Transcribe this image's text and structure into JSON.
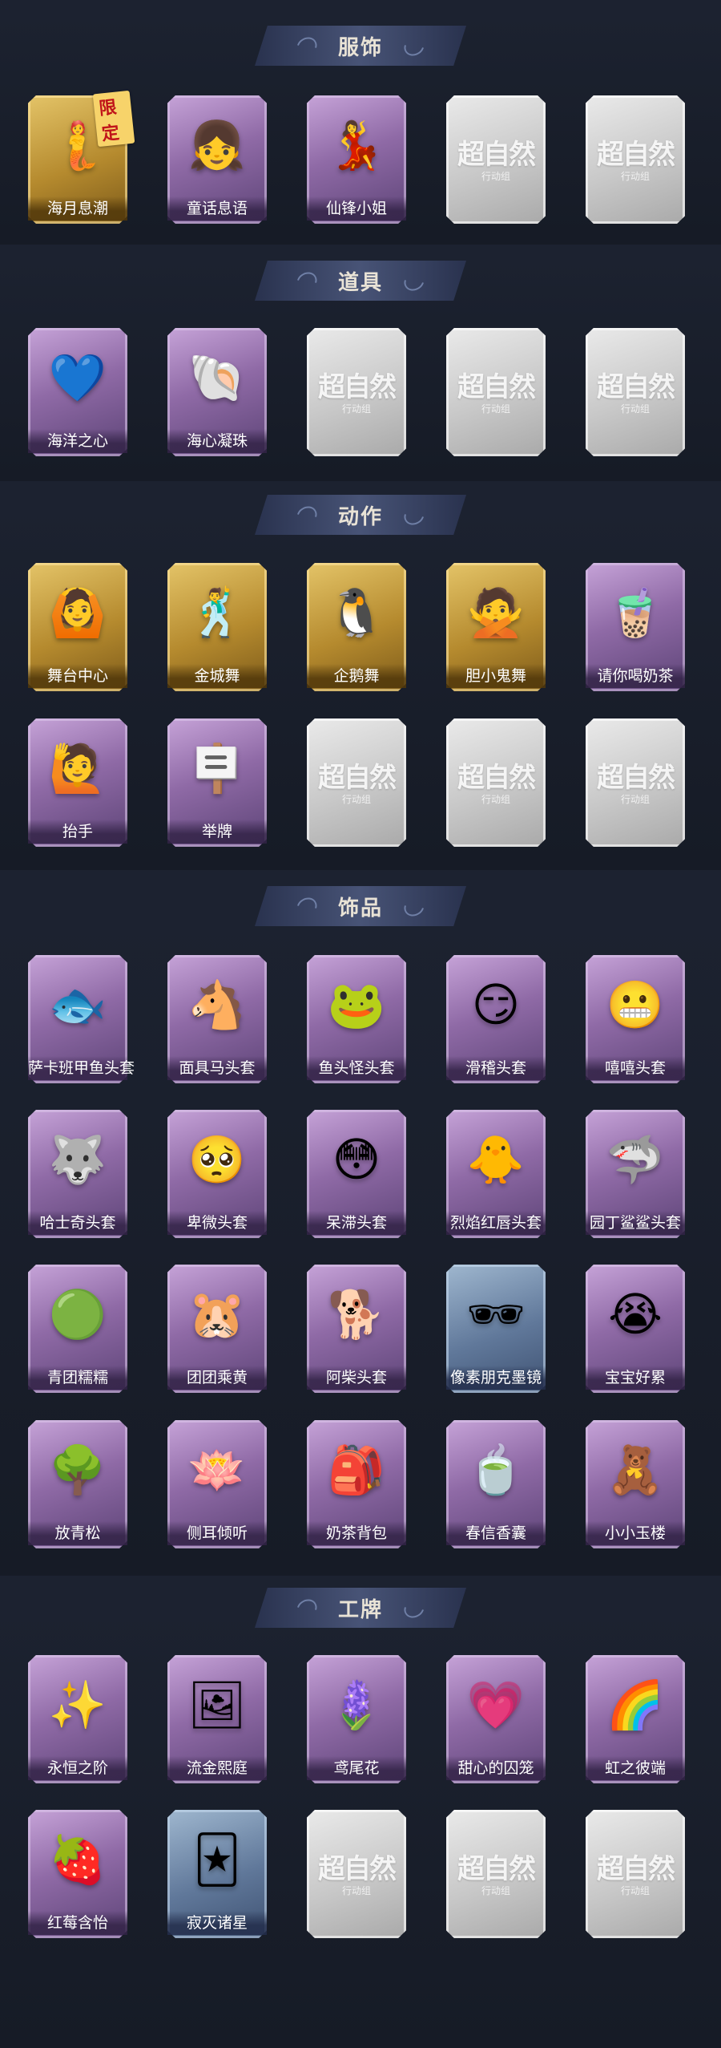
{
  "placeholder": {
    "mark": "超自然",
    "sub": "行动组"
  },
  "sections": {
    "clothing": {
      "title": "服饰",
      "badge": "限定",
      "items": [
        "海月息潮",
        "童话息语",
        "仙锋小姐"
      ]
    },
    "props": {
      "title": "道具",
      "items": [
        "海洋之心",
        "海心凝珠"
      ]
    },
    "actions": {
      "title": "动作",
      "items": [
        "舞台中心",
        "金城舞",
        "企鹅舞",
        "胆小鬼舞",
        "请你喝奶茶",
        "抬手",
        "举牌"
      ]
    },
    "accessories": {
      "title": "饰品",
      "items": [
        "萨卡班甲鱼头套",
        "面具马头套",
        "鱼头怪头套",
        "滑稽头套",
        "嘻嘻头套",
        "哈士奇头套",
        "卑微头套",
        "呆滞头套",
        "烈焰红唇头套",
        "园丁鲨鲨头套",
        "青团糯糯",
        "团团乘黄",
        "阿柴头套",
        "像素朋克墨镜",
        "宝宝好累",
        "放青松",
        "侧耳倾听",
        "奶茶背包",
        "春信香囊",
        "小小玉楼"
      ]
    },
    "badges": {
      "title": "工牌",
      "items": [
        "永恒之阶",
        "流金熙庭",
        "鸢尾花",
        "甜心的囚笼",
        "虹之彼端",
        "红莓含怡",
        "寂灭诸星"
      ]
    }
  },
  "colors": {
    "background": "#161b26",
    "purple_card": "#8f6aa6",
    "gold_card": "#b58a2e",
    "grey_card": "#c8c8c8",
    "blue_card": "#60789a",
    "limited_badge": "#c0141a"
  }
}
